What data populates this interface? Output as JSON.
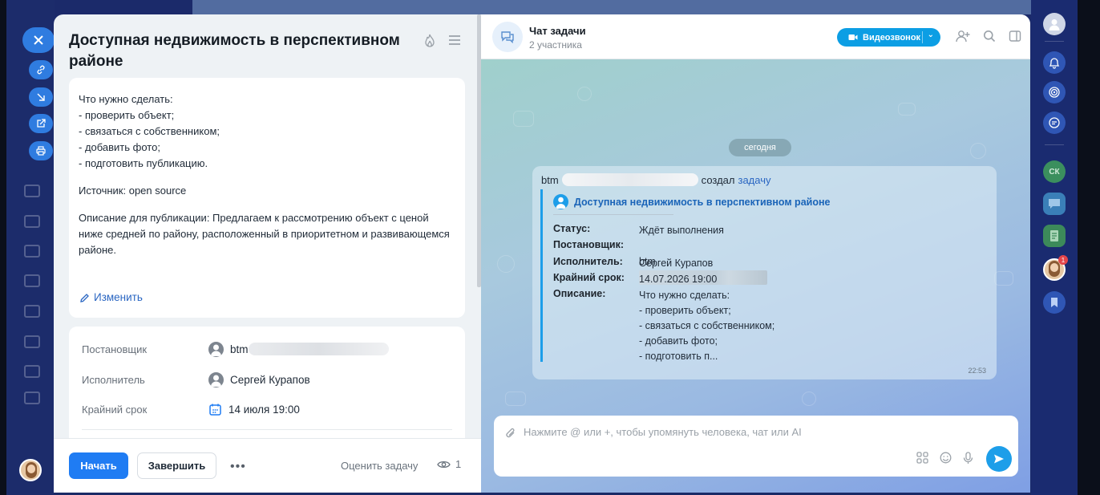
{
  "task": {
    "title": "Доступная недвижимость в перспективном районе",
    "description": "Что нужно сделать:\n- проверить объект;\n- связаться с собственником;\n- добавить фото;\n- подготовить публикацию.",
    "source": " Источник: open source",
    "publication": " Описание для публикации: Предлагаем к рассмотрению объект с ценой ниже средней по району, расположенный в приоритетном и развивающемся районе.",
    "edit_label": "Изменить",
    "creator_label": "Постановщик",
    "creator_value": "btm",
    "assignee_label": "Исполнитель",
    "assignee_value": "Сергей Курапов",
    "deadline_label": "Крайний срок",
    "deadline_value": "14 июля 19:00",
    "start_label": "Начать",
    "finish_label": "Завершить",
    "more_label": "•••",
    "rate_label": "Оценить задачу",
    "views_count": "1"
  },
  "chat": {
    "title": "Чат задачи",
    "subtitle": "2 участника",
    "video_label": "Видеозвонок",
    "date_pill": "сегодня",
    "message": {
      "author_prefix": "btm",
      "action": "создал",
      "action_link": "задачу",
      "task_title": "Доступная недвижимость в перспективном районе",
      "status_key": "Статус:",
      "status_val": "Ждёт выполнения",
      "creator_key": "Постановщик:",
      "creator_val": "btm",
      "assignee_key": "Исполнитель:",
      "assignee_val": "Сергей Курапов",
      "deadline_key": "Крайний срок:",
      "deadline_val": "14.07.2026 19:00",
      "desc_key": "Описание:",
      "desc_val": "Что нужно сделать:\n- проверить объект;\n- связаться с собственником;\n- добавить фото;\n- подготовить п...",
      "time": "22:53"
    },
    "composer_placeholder": "Нажмите @ или +, чтобы упомянуть человека, чат или AI"
  },
  "rail": {
    "initials": "СК",
    "badge": "1"
  },
  "colors": {
    "accent": "#1f7cf3",
    "chat_accent": "#1d9ee9",
    "rail_bg": "#1a2b70"
  }
}
